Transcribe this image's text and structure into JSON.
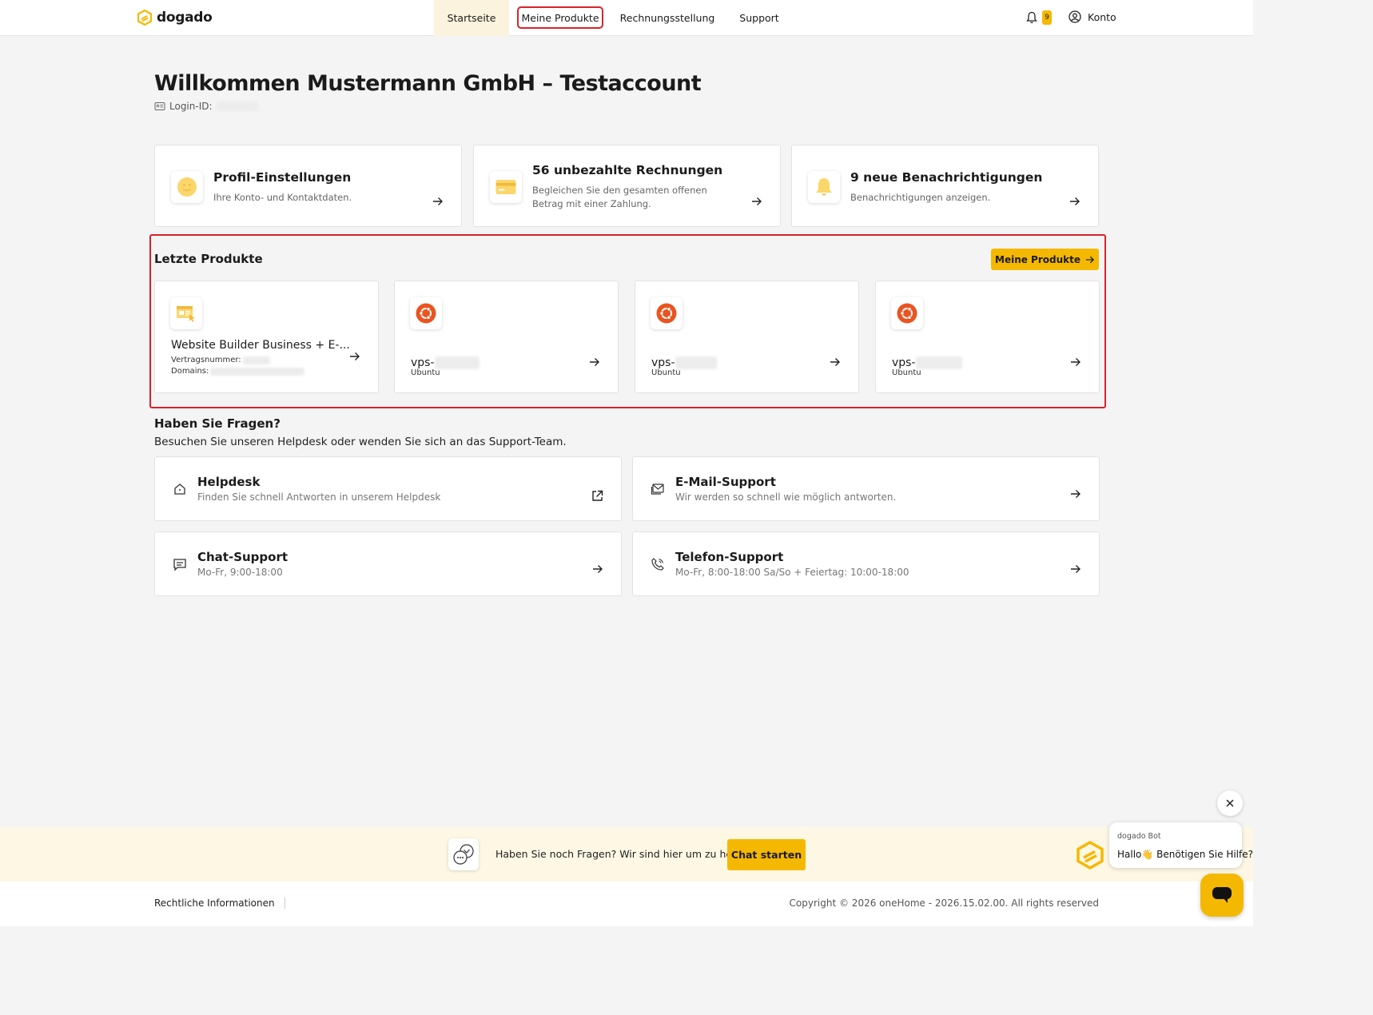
{
  "header": {
    "logo": "dogado",
    "nav": [
      "Startseite",
      "Meine Produkte",
      "Rechnungsstellung",
      "Support"
    ],
    "notification_count": "9",
    "account_label": "Konto"
  },
  "welcome": {
    "title": "Willkommen Mustermann GmbH – Testaccount",
    "login_label": "Login-ID:"
  },
  "top_cards": [
    {
      "title": "Profil-Einstellungen",
      "subtitle": "Ihre Konto- und Kontaktdaten.",
      "icon": "smiley-icon"
    },
    {
      "title": "56 unbezahlte Rechnungen",
      "subtitle": "Begleichen Sie den gesamten offenen Betrag mit einer Zahlung.",
      "icon": "credit-card-icon"
    },
    {
      "title": "9 neue Benachrichtigungen",
      "subtitle": "Benachrichtigungen anzeigen.",
      "icon": "bell-icon"
    }
  ],
  "recent": {
    "title": "Letzte Produkte",
    "button": "Meine Produkte",
    "products": [
      {
        "name": "Website Builder Business + E-...",
        "contract_label": "Vertragsnummer:",
        "domains_label": "Domains:"
      },
      {
        "name": "vps-",
        "os": "Ubuntu"
      },
      {
        "name": "vps-",
        "os": "Ubuntu"
      },
      {
        "name": "vps-",
        "os": "Ubuntu"
      }
    ]
  },
  "questions": {
    "title": "Haben Sie Fragen?",
    "subtitle": "Besuchen Sie unseren Helpdesk oder wenden Sie sich an das Support-Team.",
    "cards": [
      {
        "title": "Helpdesk",
        "subtitle": "Finden Sie schnell Antworten in unserem Helpdesk"
      },
      {
        "title": "E-Mail-Support",
        "subtitle": "Wir werden so schnell wie möglich antworten."
      },
      {
        "title": "Chat-Support",
        "subtitle": "Mo-Fr, 9:00-18:00"
      },
      {
        "title": "Telefon-Support",
        "subtitle": "Mo-Fr, 8:00-18:00 Sa/So + Feiertag: 10:00-18:00"
      }
    ]
  },
  "chat_banner": {
    "text": "Haben Sie noch Fragen? Wir sind hier um zu helfen.",
    "button": "Chat starten"
  },
  "footer": {
    "legal": "Rechtliche Informationen",
    "copyright": "Copyright © 2026 oneHome - 2026.15.02.00. All rights reserved"
  },
  "bot": {
    "name": "dogado Bot",
    "message": "Hallo👋 Benötigen Sie Hilfe?"
  },
  "colors": {
    "accent": "#f5b800",
    "highlight": "#d9222a",
    "ubuntu": "#e95420"
  }
}
